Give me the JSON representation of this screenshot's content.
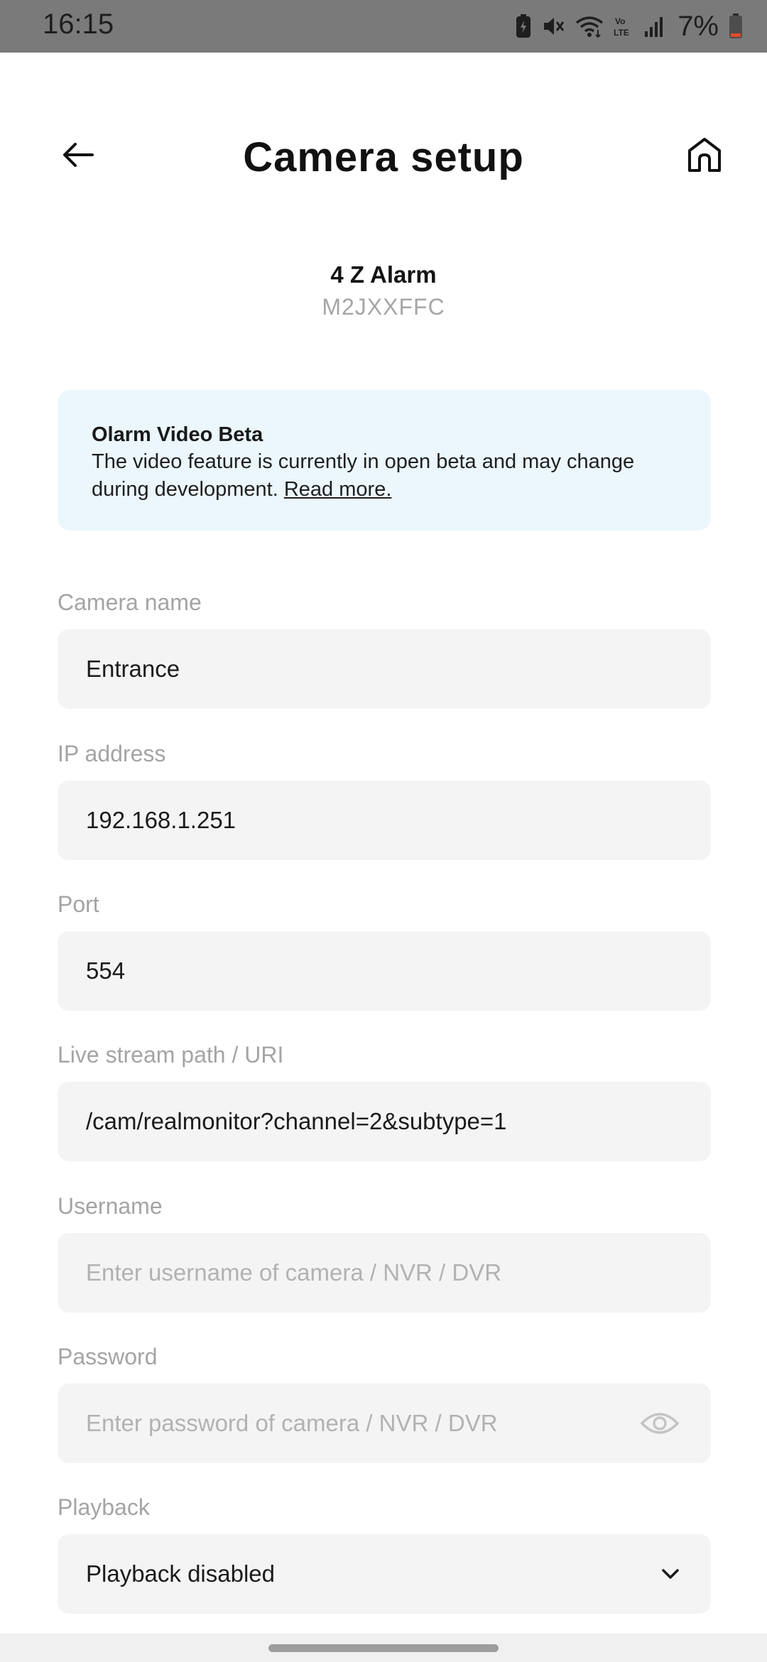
{
  "status_bar": {
    "time": "16:15",
    "battery_percent": "7%",
    "icons": [
      "data-saver-icon",
      "mute-icon",
      "wifi-icon",
      "volte-icon",
      "signal-icon",
      "battery-icon"
    ]
  },
  "header": {
    "title": "Camera setup",
    "back_icon": "arrow-left-icon",
    "home_icon": "home-icon"
  },
  "device": {
    "name": "4 Z Alarm",
    "serial": "M2JXXFFC"
  },
  "beta_notice": {
    "title": "Olarm Video Beta",
    "text": "The video feature is currently in open beta and may change during development.",
    "link": "Read more."
  },
  "form": {
    "camera_name": {
      "label": "Camera name",
      "value": "Entrance"
    },
    "ip_address": {
      "label": "IP address",
      "value": "192.168.1.251"
    },
    "port": {
      "label": "Port",
      "value": "554"
    },
    "stream_path": {
      "label": "Live stream path / URI",
      "value": "/cam/realmonitor?channel=2&subtype=1"
    },
    "username": {
      "label": "Username",
      "placeholder": "Enter username of camera / NVR / DVR"
    },
    "password": {
      "label": "Password",
      "placeholder": "Enter password of camera / NVR / DVR",
      "toggle_icon": "eye-icon"
    },
    "playback": {
      "label": "Playback",
      "value": "Playback disabled",
      "dropdown_icon": "chevron-down-icon"
    }
  },
  "colors": {
    "status_bar": "#7a7a7a",
    "beta_card_bg": "#ebf7fc",
    "field_bg": "#f4f4f4",
    "label_text": "#a4a4a4",
    "placeholder_text": "#b2b2b2"
  }
}
